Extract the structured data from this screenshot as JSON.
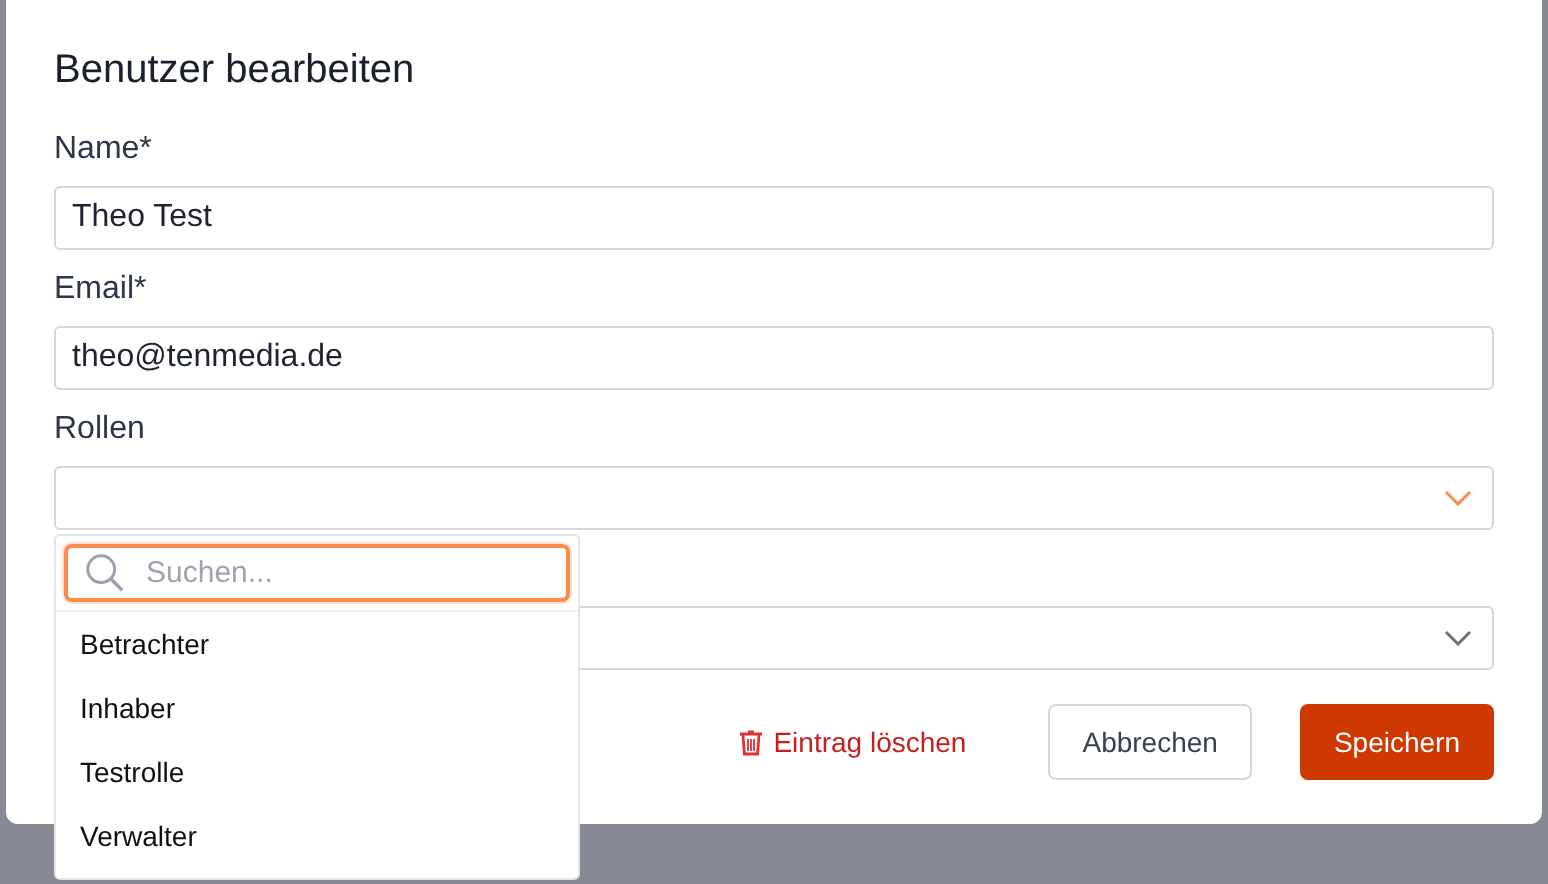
{
  "dialog": {
    "title": "Benutzer bearbeiten"
  },
  "fields": [
    {
      "kind": "text",
      "label": "Name*",
      "value": "Theo Test"
    },
    {
      "kind": "text",
      "label": "Email*",
      "value": "theo@tenmedia.de"
    },
    {
      "kind": "select",
      "label": "Rollen",
      "expanded": true
    },
    {
      "kind": "select",
      "expanded": false
    }
  ],
  "dropdown": {
    "search": {
      "placeholder": "Suchen..."
    },
    "options": [
      "Betrachter",
      "Inhaber",
      "Testrolle",
      "Verwalter"
    ]
  },
  "actions": {
    "delete": "Eintrag löschen",
    "cancel": "Abbrechen",
    "save": "Speichern"
  }
}
